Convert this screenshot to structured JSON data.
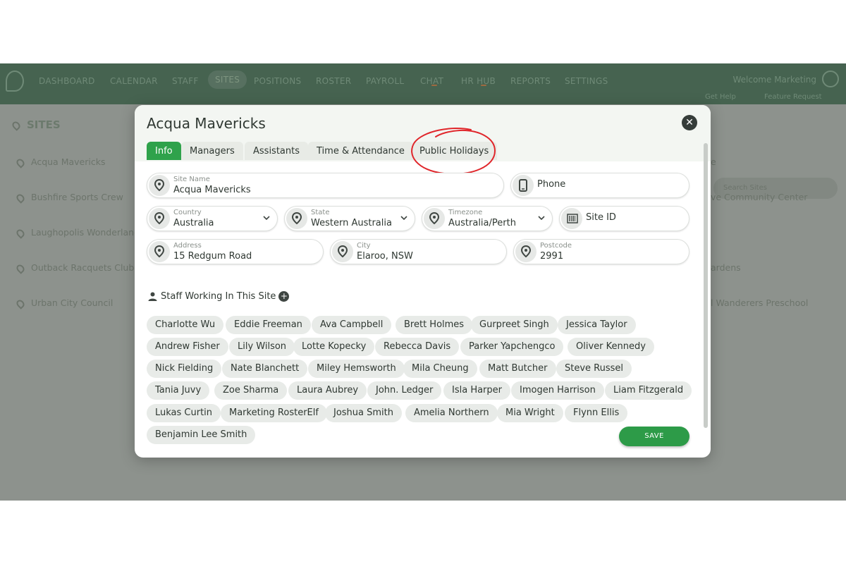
{
  "nav": {
    "items": [
      "DASHBOARD",
      "CALENDAR",
      "STAFF",
      "SITES",
      "POSITIONS",
      "ROSTER",
      "PAYROLL",
      "CHAT",
      "HR HUB",
      "REPORTS",
      "SETTINGS"
    ],
    "welcome": "Welcome Marketing",
    "get_help": "Get Help",
    "feature_request": "Feature Request"
  },
  "sites_page": {
    "title": "SITES",
    "search_placeholder": "Search Sites",
    "left_sites": [
      "Acqua Mavericks",
      "Bushfire Sports Crew",
      "Laughopolis Wonderland",
      "Outback Racquets Club",
      "Urban City Council"
    ],
    "right_sites": [
      "e",
      "ve Community Center",
      "ardens",
      "l Wanderers Preschool"
    ]
  },
  "modal": {
    "title": "Acqua Mavericks",
    "tabs": [
      "Info",
      "Managers",
      "Assistants",
      "Time & Attendance",
      "Public Holidays"
    ],
    "active_tab": "Info",
    "fields": {
      "site_name": {
        "label": "Site Name",
        "value": "Acqua Mavericks"
      },
      "phone": {
        "label": "Phone"
      },
      "country": {
        "label": "Country",
        "value": "Australia"
      },
      "state": {
        "label": "State",
        "value": "Western Australia"
      },
      "timezone": {
        "label": "Timezone",
        "value": "Australia/Perth"
      },
      "site_id": {
        "label": "Site ID"
      },
      "address": {
        "label": "Address",
        "value": "15 Redgum Road"
      },
      "city": {
        "label": "City",
        "value": "Elaroo, NSW"
      },
      "postcode": {
        "label": "Postcode",
        "value": "2991"
      }
    },
    "staff_heading": "Staff Working In This Site",
    "staff": [
      "Charlotte Wu",
      "Eddie Freeman",
      "Ava Campbell",
      "Brett Holmes",
      "Gurpreet Singh",
      "Jessica Taylor",
      "Andrew Fisher",
      "Lily Wilson",
      "Lotte Kopecky",
      "Rebecca Davis",
      "Parker Yapchengco",
      "Oliver Kennedy",
      "Nick Fielding",
      "Nate Blanchett",
      "Miley Hemsworth",
      "Mila Cheung",
      "Matt Butcher",
      "Steve Russel",
      "Tania Juvy",
      "Zoe Sharma",
      "Laura Aubrey",
      "John. Ledger",
      "Isla Harper",
      "Imogen Harrison",
      "Liam Fitzgerald",
      "Lukas Curtin",
      "Marketing RosterElf",
      "Joshua Smith",
      "Amelia Northern",
      "Mia Wright",
      "Flynn Ellis",
      "Benjamin Lee Smith"
    ],
    "save_label": "SAVE"
  },
  "colors": {
    "accent_green": "#2fa24b",
    "annotation_red": "#e0262b",
    "topbar": "#466350",
    "overlay": "#8d928d"
  }
}
